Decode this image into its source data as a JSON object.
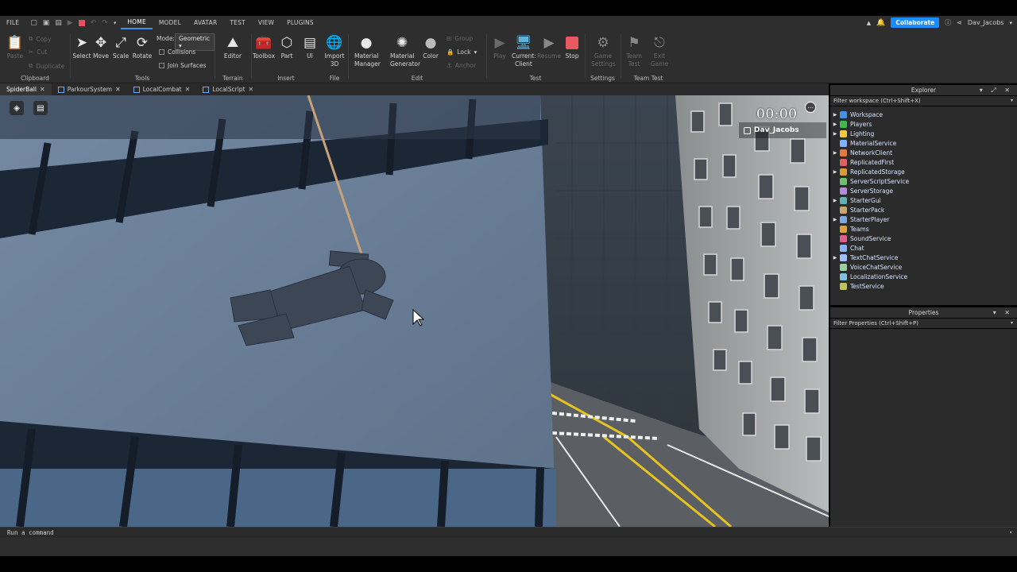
{
  "menu": {
    "items": [
      "FILE",
      "HOME",
      "MODEL",
      "AVATAR",
      "TEST",
      "VIEW",
      "PLUGINS"
    ],
    "active": "HOME",
    "collaborate": "Collaborate",
    "username": "Dav_Jacobs"
  },
  "ribbon": {
    "clipboard": {
      "paste": "Paste",
      "copy": "Copy",
      "cut": "Cut",
      "duplicate": "Duplicate",
      "label": "Clipboard"
    },
    "tools": {
      "select": "Select",
      "move": "Move",
      "scale": "Scale",
      "rotate": "Rotate",
      "mode_label": "Mode:",
      "mode_value": "Geometric",
      "collisions": "Collisions",
      "join_surfaces": "Join Surfaces",
      "label": "Tools"
    },
    "terrain": {
      "editor": "Editor",
      "label": "Terrain"
    },
    "insert": {
      "toolbox": "Toolbox",
      "part": "Part",
      "ui": "UI",
      "label": "Insert"
    },
    "file": {
      "import3d_1": "Import",
      "import3d_2": "3D",
      "label": "File"
    },
    "edit": {
      "material_manager_1": "Material",
      "material_manager_2": "Manager",
      "material_generator_1": "Material",
      "material_generator_2": "Generator",
      "color": "Color",
      "group": "Group",
      "lock": "Lock",
      "anchor": "Anchor",
      "label": "Edit"
    },
    "test": {
      "play": "Play",
      "current_client_1": "Current:",
      "current_client_2": "Client",
      "resume": "Resume",
      "stop": "Stop",
      "label": "Test"
    },
    "settings": {
      "game_settings_1": "Game",
      "game_settings_2": "Settings",
      "label": "Settings"
    },
    "team_test": {
      "team_test_1": "Team",
      "team_test_2": "Test",
      "exit_game_1": "Exit",
      "exit_game_2": "Game",
      "label": "Team Test"
    }
  },
  "tabs": [
    {
      "label": "SpiderBall",
      "active": true
    },
    {
      "label": "ParkourSystem",
      "active": false
    },
    {
      "label": "LocalCombat",
      "active": false
    },
    {
      "label": "LocalScript",
      "active": false
    }
  ],
  "viewport": {
    "timer": "00:00",
    "player_name": "Dav_Jacobs"
  },
  "explorer": {
    "title": "Explorer",
    "filter": "Filter workspace (Ctrl+Shift+X)",
    "items": [
      {
        "name": "Workspace",
        "expandable": true,
        "color": "#4a90e2"
      },
      {
        "name": "Players",
        "expandable": true,
        "color": "#3fb950"
      },
      {
        "name": "Lighting",
        "expandable": true,
        "color": "#f2c744"
      },
      {
        "name": "MaterialService",
        "expandable": false,
        "color": "#7fb3ff"
      },
      {
        "name": "NetworkClient",
        "expandable": true,
        "color": "#e07a3f"
      },
      {
        "name": "ReplicatedFirst",
        "expandable": false,
        "color": "#e06060"
      },
      {
        "name": "ReplicatedStorage",
        "expandable": true,
        "color": "#d99a3a"
      },
      {
        "name": "ServerScriptService",
        "expandable": false,
        "color": "#6fbf73"
      },
      {
        "name": "ServerStorage",
        "expandable": false,
        "color": "#b58cd9"
      },
      {
        "name": "StarterGui",
        "expandable": true,
        "color": "#5fb3b3"
      },
      {
        "name": "StarterPack",
        "expandable": false,
        "color": "#c9a66b"
      },
      {
        "name": "StarterPlayer",
        "expandable": true,
        "color": "#7fa7e0"
      },
      {
        "name": "Teams",
        "expandable": false,
        "color": "#e0a040"
      },
      {
        "name": "SoundService",
        "expandable": false,
        "color": "#e05f8a"
      },
      {
        "name": "Chat",
        "expandable": false,
        "color": "#8ab4f8"
      },
      {
        "name": "TextChatService",
        "expandable": true,
        "color": "#a0c0ff"
      },
      {
        "name": "VoiceChatService",
        "expandable": false,
        "color": "#9ad0a0"
      },
      {
        "name": "LocalizationService",
        "expandable": false,
        "color": "#80c0e0"
      },
      {
        "name": "TestService",
        "expandable": false,
        "color": "#c0c060"
      }
    ]
  },
  "properties": {
    "title": "Properties",
    "filter": "Filter Properties (Ctrl+Shift+P)"
  },
  "command": {
    "placeholder": "Run a command"
  }
}
